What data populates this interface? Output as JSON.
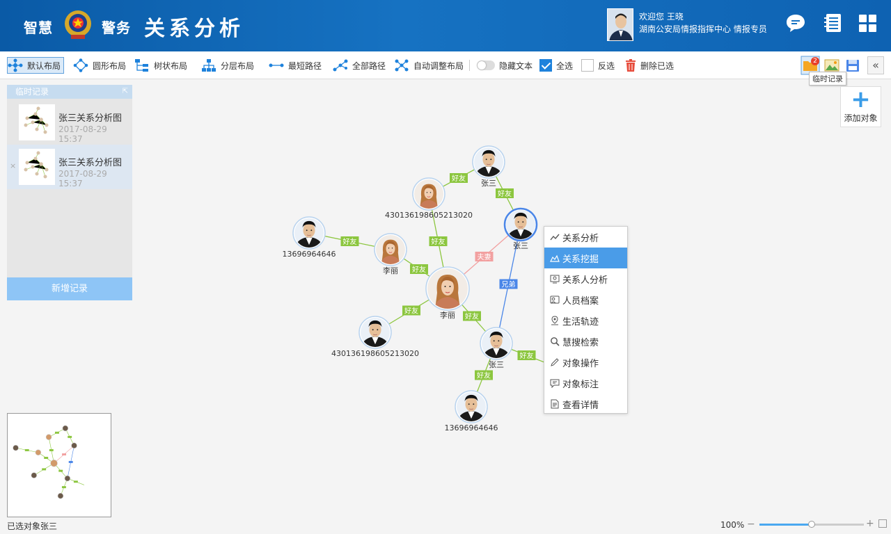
{
  "header": {
    "brand_left": "智慧",
    "brand_right": "警务",
    "title": "关系分析",
    "welcome": "欢迎您 王晓",
    "org": "湖南公安局情报指挥中心 情报专员",
    "icons": [
      "chat-icon",
      "notebook-icon",
      "apps-grid-icon"
    ]
  },
  "toolbar": {
    "layouts": [
      {
        "label": "默认布局",
        "icon": "default-layout-icon",
        "active": true
      },
      {
        "label": "圆形布局",
        "icon": "circle-layout-icon"
      },
      {
        "label": "树状布局",
        "icon": "tree-layout-icon"
      },
      {
        "label": "分层布局",
        "icon": "layer-layout-icon"
      },
      {
        "label": "最短路径",
        "icon": "shortest-path-icon"
      },
      {
        "label": "全部路径",
        "icon": "all-paths-icon"
      },
      {
        "label": "自动调整布局",
        "icon": "auto-layout-icon"
      }
    ],
    "hide_text": "隐藏文本",
    "select_all": "全选",
    "select_all_checked": true,
    "invert": "反选",
    "invert_checked": false,
    "delete_selected": "删除已选",
    "temp_badge": "2",
    "tooltip": "临时记录"
  },
  "records": {
    "title": "临时记录",
    "items": [
      {
        "name": "张三关系分析图",
        "time": "2017-08-29 15:37"
      },
      {
        "name": "张三关系分析图",
        "time": "2017-08-29 15:37"
      }
    ],
    "close_glyph": "×",
    "new_button": "新增记录"
  },
  "add_object": {
    "plus": "+",
    "label": "添加对象"
  },
  "graph": {
    "nodes": [
      {
        "id": "center",
        "label": "李丽"
      },
      {
        "id": "lili2",
        "label": "李丽"
      },
      {
        "id": "id1",
        "label": "430136198605213020"
      },
      {
        "id": "zs_top",
        "label": "张三"
      },
      {
        "id": "zs_sel",
        "label": "张三"
      },
      {
        "id": "phone1",
        "label": "13696964646"
      },
      {
        "id": "id2",
        "label": "430136198605213020"
      },
      {
        "id": "zs_low",
        "label": "张三"
      },
      {
        "id": "phone2",
        "label": "13696964646"
      }
    ],
    "edges": [
      {
        "from": "id1",
        "to": "zs_top",
        "label": "好友",
        "type": "friend"
      },
      {
        "from": "zs_top",
        "to": "zs_sel",
        "label": "好友",
        "type": "friend"
      },
      {
        "from": "id1",
        "to": "center",
        "label": "好友",
        "type": "friend"
      },
      {
        "from": "phone1",
        "to": "lili2",
        "label": "好友",
        "type": "friend"
      },
      {
        "from": "lili2",
        "to": "center",
        "label": "好友",
        "type": "friend"
      },
      {
        "from": "center",
        "to": "zs_sel",
        "label": "夫妻",
        "type": "spouse"
      },
      {
        "from": "zs_sel",
        "to": "zs_low",
        "label": "兄弟",
        "type": "brother"
      },
      {
        "from": "center",
        "to": "id2",
        "label": "好友",
        "type": "friend"
      },
      {
        "from": "center",
        "to": "zs_low",
        "label": "好友",
        "type": "friend"
      },
      {
        "from": "zs_low",
        "to": "phone2",
        "label": "好友",
        "type": "friend"
      },
      {
        "from": "zs_low",
        "to": "offscreen",
        "label": "好友",
        "type": "friend"
      }
    ]
  },
  "context_menu": {
    "items": [
      {
        "label": "关系分析",
        "icon": "relation-analysis-icon"
      },
      {
        "label": "关系挖掘",
        "icon": "relation-mining-icon",
        "active": true
      },
      {
        "label": "关系人分析",
        "icon": "related-person-icon"
      },
      {
        "label": "人员档案",
        "icon": "person-profile-icon"
      },
      {
        "label": "生活轨迹",
        "icon": "location-pin-icon"
      },
      {
        "label": "慧搜检索",
        "icon": "search-icon"
      },
      {
        "label": "对象操作",
        "icon": "edit-pencil-icon"
      },
      {
        "label": "对象标注",
        "icon": "comment-icon"
      },
      {
        "label": "查看详情",
        "icon": "document-icon"
      }
    ]
  },
  "status": {
    "selected": "已选对象张三",
    "zoom": "100%",
    "zoom_minus": "−",
    "zoom_plus": "+",
    "zoom_level": 0.5
  },
  "colors": {
    "friend": "#8cc63f",
    "spouse": "#f2a0a0",
    "brother": "#4a86e8",
    "accent": "#1e82dc"
  }
}
